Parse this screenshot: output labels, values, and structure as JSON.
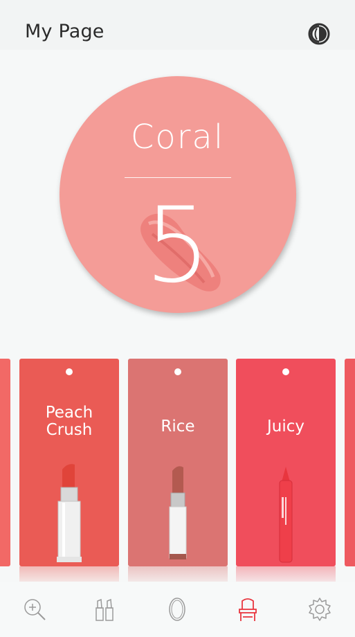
{
  "header": {
    "title": "My Page"
  },
  "summary": {
    "shade_name": "Coral",
    "shade_number": "5"
  },
  "cards": [
    {
      "name": "Peach Crush",
      "color": "#ea5b55"
    },
    {
      "name": "Rice",
      "color": "#db7472"
    },
    {
      "name": "Juicy",
      "color": "#f04e5c"
    }
  ],
  "nav": [
    {
      "icon": "search-plus-icon"
    },
    {
      "icon": "lipsticks-icon"
    },
    {
      "icon": "mirror-icon"
    },
    {
      "icon": "vanity-icon",
      "active": true
    },
    {
      "icon": "settings-icon"
    }
  ],
  "colors": {
    "accent": "#e8363f",
    "circle": "#f49c97",
    "edge_left": "#f26966",
    "edge_right": "#ee5a60"
  }
}
